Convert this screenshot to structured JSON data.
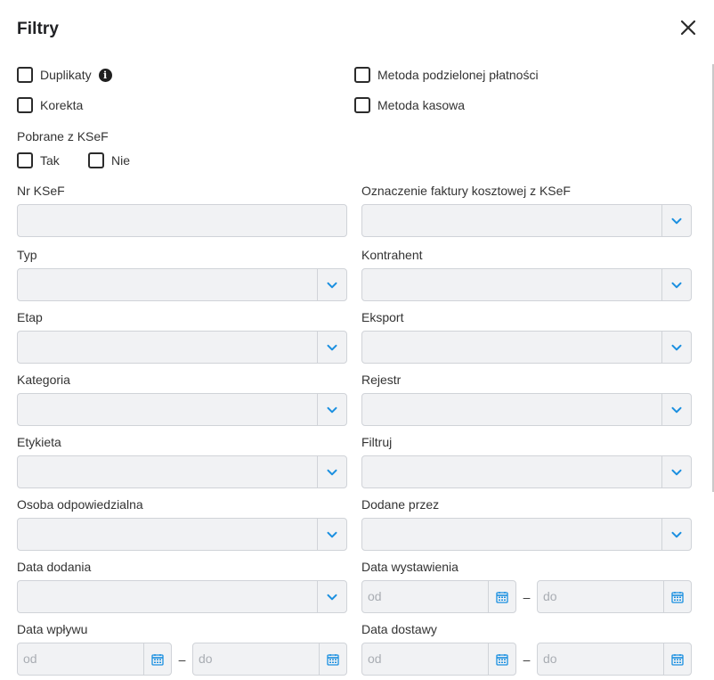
{
  "dialog": {
    "title": "Filtry"
  },
  "checkboxes": {
    "duplikaty": "Duplikaty",
    "metoda_podzielonej": "Metoda podzielonej płatności",
    "korekta": "Korekta",
    "metoda_kasowa": "Metoda kasowa"
  },
  "pobrane": {
    "label": "Pobrane z KSeF",
    "tak": "Tak",
    "nie": "Nie"
  },
  "fields": {
    "nr_ksef": "Nr KSeF",
    "oznaczenie": "Oznaczenie faktury kosztowej z KSeF",
    "typ": "Typ",
    "kontrahent": "Kontrahent",
    "etap": "Etap",
    "eksport": "Eksport",
    "kategoria": "Kategoria",
    "rejestr": "Rejestr",
    "etykieta": "Etykieta",
    "filtruj": "Filtruj",
    "osoba": "Osoba odpowiedzialna",
    "dodane_przez": "Dodane przez",
    "data_dodania": "Data dodania",
    "data_wystawienia": "Data wystawienia",
    "data_wplywu": "Data wpływu",
    "data_dostawy": "Data dostawy"
  },
  "date_placeholders": {
    "from": "od",
    "to": "do",
    "separator": "–"
  },
  "icons": {
    "close": "close-icon",
    "info": "info-icon",
    "chevron": "chevron-down-icon",
    "calendar": "calendar-icon"
  },
  "colors": {
    "accent": "#1a8fe0",
    "field_bg": "#f1f2f4",
    "field_border": "#d0d3d8"
  }
}
